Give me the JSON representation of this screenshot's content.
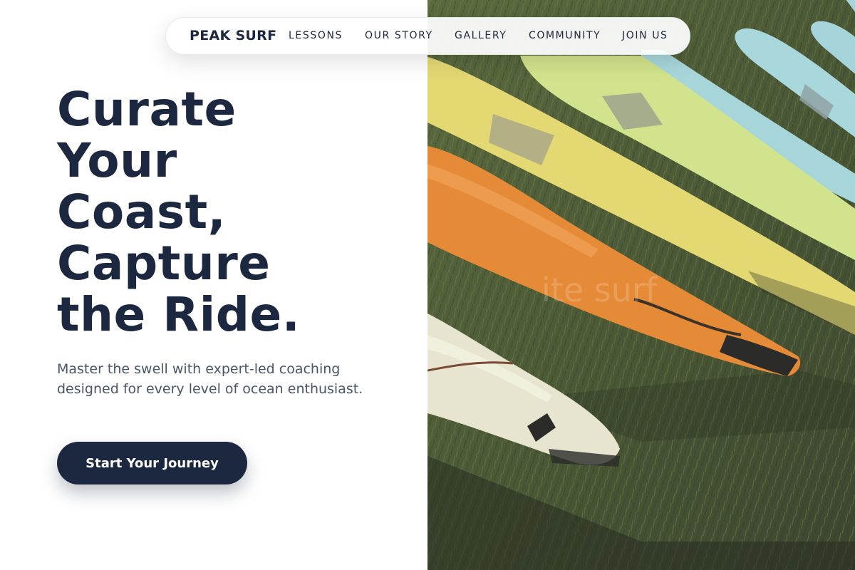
{
  "nav": {
    "brand": "PEAK SURF",
    "links": [
      {
        "label": "LESSONS"
      },
      {
        "label": "OUR STORY"
      },
      {
        "label": "GALLERY"
      },
      {
        "label": "COMMUNITY"
      },
      {
        "label": "JOIN US"
      }
    ]
  },
  "hero": {
    "title_lines": [
      "Curate",
      "Your",
      "Coast,",
      "Capture",
      "the Ride."
    ],
    "subtitle": "Master the swell with expert-led coaching designed for every level of ocean enthusiast.",
    "cta_label": "Start Your Journey"
  },
  "image": {
    "subject": "surfboards",
    "watermark": "ite surf"
  },
  "colors": {
    "primary": "#1c2740",
    "text_muted": "#4a5568",
    "background": "#ffffff"
  }
}
